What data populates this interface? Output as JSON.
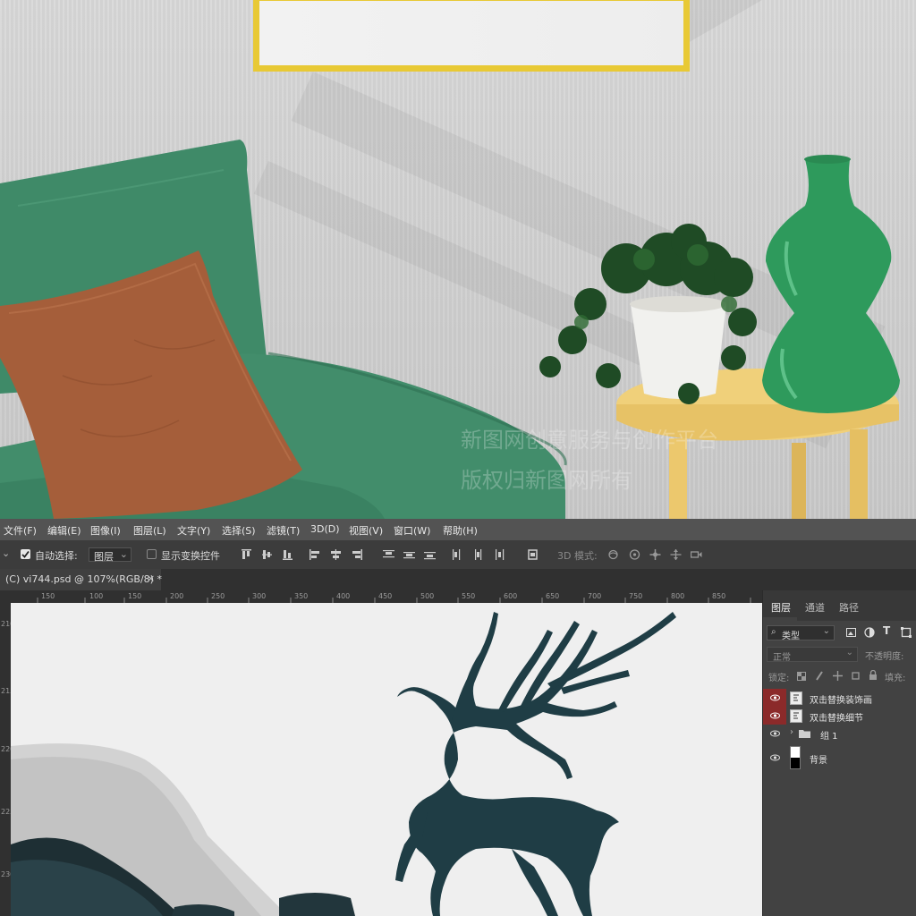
{
  "menu": [
    "文件(F)",
    "编辑(E)",
    "图像(I)",
    "图层(L)",
    "文字(Y)",
    "选择(S)",
    "滤镜(T)",
    "3D(D)",
    "视图(V)",
    "窗口(W)",
    "帮助(H)"
  ],
  "options": {
    "auto_select_label": "自动选择:",
    "auto_select_checked": true,
    "auto_select_target": "图层",
    "show_transform_label": "显示变换控件",
    "mode_3d_label": "3D 模式:"
  },
  "document_tab": "(C) vi744.psd @ 107%(RGB/8) *",
  "ruler": {
    "h_ticks": [
      "150",
      "100",
      "150",
      "200",
      "250",
      "300",
      "350",
      "400",
      "450",
      "500",
      "550",
      "600",
      "650",
      "700",
      "750",
      "800",
      "850",
      "900",
      "950"
    ],
    "v_ticks": [
      "2100",
      "2150",
      "2200",
      "2250",
      "2300"
    ]
  },
  "watermark": {
    "line1": "新图网创意服务与创作平台",
    "line2": "版权归新图网所有"
  },
  "layers_panel": {
    "tabs": [
      "图层",
      "通道",
      "路径"
    ],
    "filter_label": "类型",
    "blend_mode": "正常",
    "opacity_label": "不透明度:",
    "lock_label": "锁定:",
    "fill_label": "填充:",
    "layers": [
      {
        "name": "双击替换装饰画",
        "visible": true,
        "highlighted": true,
        "kind": "smart"
      },
      {
        "name": "双击替换细节",
        "visible": true,
        "highlighted": true,
        "kind": "smart"
      },
      {
        "name": "组 1",
        "visible": true,
        "highlighted": false,
        "kind": "group"
      },
      {
        "name": "背景",
        "visible": true,
        "highlighted": false,
        "kind": "background"
      }
    ]
  },
  "colors": {
    "frame_gold": "#e8c935",
    "armchair_green": "#3f8a68",
    "pillow_brown": "#a55e3a",
    "vase_green": "#2e9a5c",
    "stool_yellow": "#f0d07a",
    "deer_teal": "#1f3d45",
    "ps_highlight_red": "#8b2a2a"
  }
}
